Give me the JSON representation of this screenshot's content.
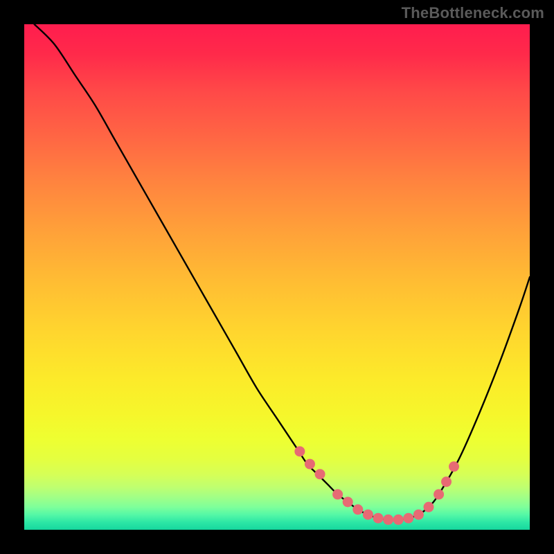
{
  "watermark": "TheBottleneck.com",
  "colors": {
    "background": "#000000",
    "gradient_top": "#ff1d4e",
    "gradient_mid": "#ffd62e",
    "gradient_bottom": "#16d79e",
    "curve_stroke": "#000000",
    "marker_fill": "#e76a74",
    "marker_stroke": "#c94a57"
  },
  "chart_data": {
    "type": "line",
    "title": "",
    "xlabel": "",
    "ylabel": "",
    "xlim": [
      0,
      100
    ],
    "ylim": [
      0,
      100
    ],
    "grid": false,
    "legend": false,
    "series": [
      {
        "name": "bottleneck-curve",
        "x": [
          2,
          6,
          10,
          14,
          18,
          22,
          26,
          30,
          34,
          38,
          42,
          46,
          50,
          54,
          56,
          58,
          60,
          62,
          64,
          66,
          68,
          70,
          72,
          74,
          76,
          78,
          80,
          82,
          86,
          90,
          94,
          98,
          100
        ],
        "y": [
          100,
          96,
          90,
          84,
          77,
          70,
          63,
          56,
          49,
          42,
          35,
          28,
          22,
          16,
          13,
          11,
          9,
          7,
          5.5,
          4,
          3,
          2.3,
          2,
          2,
          2.3,
          3,
          4.5,
          7,
          14,
          23,
          33,
          44,
          50
        ]
      }
    ],
    "markers": {
      "name": "highlight-dots",
      "x": [
        54.5,
        56.5,
        58.5,
        62,
        64,
        66,
        68,
        70,
        72,
        74,
        76,
        78,
        80,
        82,
        83.5,
        85
      ],
      "y": [
        15.5,
        13,
        11,
        7,
        5.5,
        4,
        3,
        2.3,
        2,
        2,
        2.3,
        3,
        4.5,
        7,
        9.5,
        12.5
      ]
    }
  }
}
